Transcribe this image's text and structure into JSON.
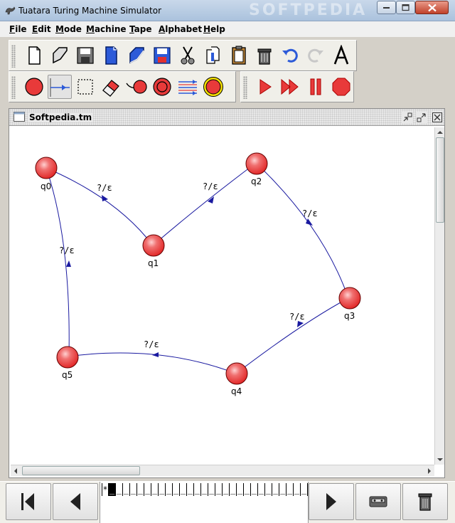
{
  "window": {
    "title": "Tuatara Turing Machine Simulator",
    "watermark": "SOFTPEDIA"
  },
  "menu": [
    {
      "label": "File",
      "mnemonic": "F",
      "rest": "ile"
    },
    {
      "label": "Edit",
      "mnemonic": "E",
      "rest": "dit"
    },
    {
      "label": "Mode",
      "mnemonic": "M",
      "rest": "ode"
    },
    {
      "label": "Machine",
      "mnemonic": "M",
      "rest": "achine"
    },
    {
      "label": "Tape",
      "mnemonic": "T",
      "rest": "ape"
    },
    {
      "label": "Alphabet",
      "mnemonic": "A",
      "rest": "lphabet"
    },
    {
      "label": "Help",
      "mnemonic": "H",
      "rest": "elp"
    }
  ],
  "toolbar1": {
    "buttons": [
      "new-file-icon",
      "open-icon",
      "save-icon",
      "new-tape-icon",
      "open-tape-icon",
      "save-tape-icon",
      "cut-icon",
      "copy-icon",
      "paste-icon",
      "delete-icon",
      "undo-icon",
      "redo-icon",
      "font-icon"
    ]
  },
  "toolbar2": {
    "mode_buttons": [
      "add-state-icon",
      "add-transition-icon",
      "select-icon",
      "eraser-icon",
      "start-state-icon",
      "accept-state-icon",
      "configure-icon",
      "highlight-state-icon"
    ],
    "run_buttons": [
      "step-icon",
      "fast-forward-icon",
      "pause-icon",
      "stop-icon"
    ],
    "active": "add-transition-icon"
  },
  "document": {
    "title": "Softpedia.tm"
  },
  "machine": {
    "states": [
      {
        "name": "q0"
      },
      {
        "name": "q1"
      },
      {
        "name": "q2"
      },
      {
        "name": "q3"
      },
      {
        "name": "q4"
      },
      {
        "name": "q5"
      }
    ],
    "transitions": [
      {
        "from": "q0",
        "to": "q1",
        "label": "?/ε"
      },
      {
        "from": "q1",
        "to": "q2",
        "label": "?/ε"
      },
      {
        "from": "q2",
        "to": "q3",
        "label": "?/ε"
      },
      {
        "from": "q3",
        "to": "q4",
        "label": "?/ε"
      },
      {
        "from": "q4",
        "to": "q5",
        "label": "?/ε"
      },
      {
        "from": "q5",
        "to": "q0",
        "label": "?/ε"
      }
    ],
    "state_color": "#e83a3a"
  },
  "tape": {
    "cells": [
      "*",
      "_",
      "_",
      "_",
      "_",
      "_",
      "_",
      "_",
      "_",
      "_",
      "_",
      "_",
      "_",
      "_",
      "_",
      "_",
      "_",
      "_",
      "_",
      "_",
      "_",
      "_",
      "_",
      "_",
      "_",
      "_",
      "_",
      "_",
      "_"
    ],
    "head_index": 1
  },
  "tape_controls": [
    "rewind-icon",
    "move-left-icon",
    "move-right-icon",
    "tape-settings-icon",
    "clear-tape-icon"
  ]
}
